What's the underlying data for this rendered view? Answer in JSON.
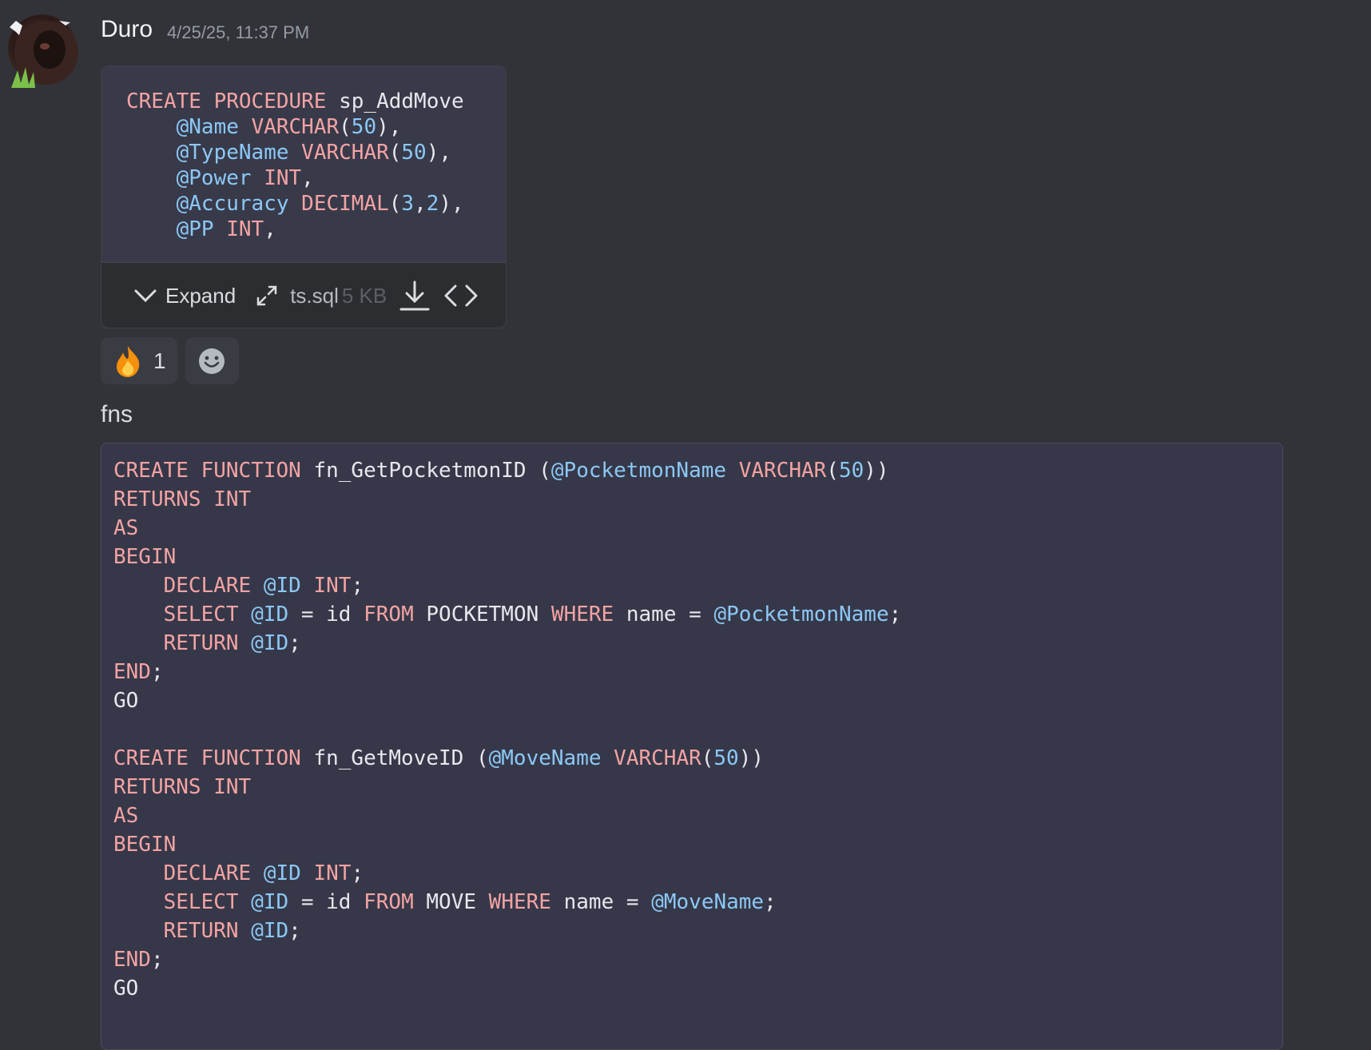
{
  "message": {
    "author": "Duro",
    "timestamp": "4/25/25, 11:37 PM",
    "avatar_icon": "avatar-image"
  },
  "attachment": {
    "preview_lines": [
      "CREATE PROCEDURE sp_AddMove",
      "    @Name VARCHAR(50),",
      "    @TypeName VARCHAR(50),",
      "    @Power INT,",
      "    @Accuracy DECIMAL(3,2),",
      "    @PP INT,"
    ],
    "expand_label": "Expand",
    "file_name": "ts.sql",
    "file_size": "5 KB",
    "icons": [
      "chevron-down-icon",
      "fullscreen-icon",
      "download-icon",
      "code-icon"
    ]
  },
  "reactions": [
    {
      "emoji": "🔥",
      "count": "1"
    }
  ],
  "add_reaction_icon": "smile-icon",
  "text": "fns",
  "code_block": {
    "lines": [
      "CREATE FUNCTION fn_GetPocketmonID (@PocketmonName VARCHAR(50))",
      "RETURNS INT",
      "AS",
      "BEGIN",
      "    DECLARE @ID INT;",
      "    SELECT @ID = id FROM POCKETMON WHERE name = @PocketmonName;",
      "    RETURN @ID;",
      "END;",
      "GO",
      "",
      "CREATE FUNCTION fn_GetMoveID (@MoveName VARCHAR(50))",
      "RETURNS INT",
      "AS",
      "BEGIN",
      "    DECLARE @ID INT;",
      "    SELECT @ID = id FROM MOVE WHERE name = @MoveName;",
      "    RETURN @ID;",
      "END;",
      "GO"
    ]
  },
  "colors": {
    "background": "#323339",
    "keyword": "#f4a3a3",
    "variable": "#8cc8f5",
    "code_bg": "#363849"
  }
}
